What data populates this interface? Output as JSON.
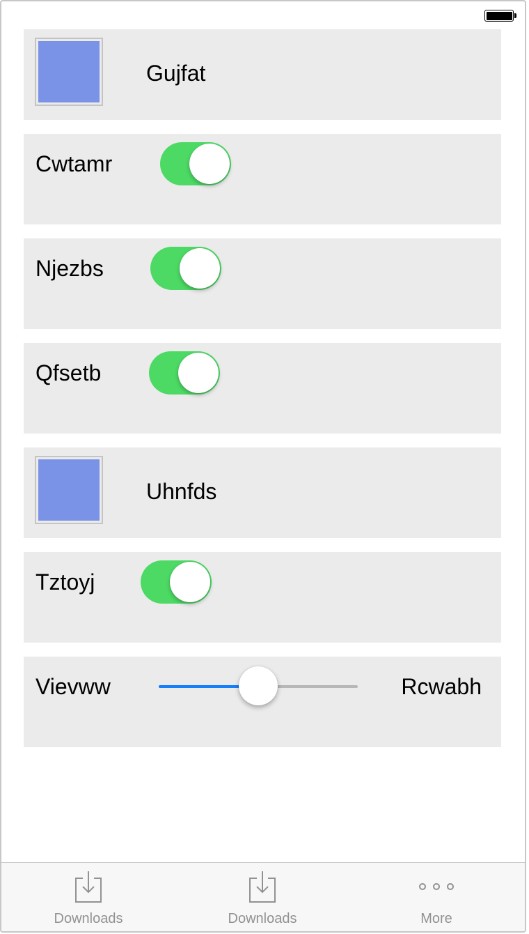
{
  "colors": {
    "switch_on": "#4cd964",
    "slider_fill": "#157efb",
    "swatch": "#7b93e6"
  },
  "rows": {
    "gujfat": {
      "label": "Gujfat",
      "swatch_color": "#7b93e6"
    },
    "cwtamr": {
      "label": "Cwtamr",
      "switch_on": true
    },
    "njezbs": {
      "label": "Njezbs",
      "switch_on": true
    },
    "qfsetb": {
      "label": "Qfsetb",
      "switch_on": true
    },
    "uhnfds": {
      "label": "Uhnfds",
      "swatch_color": "#7b93e6"
    },
    "tztoyj": {
      "label": "Tztoyj",
      "switch_on": true
    },
    "slider_row": {
      "left_label": "Vievww",
      "right_label": "Rcwabh",
      "value": 0.5
    }
  },
  "tab_bar": {
    "items": [
      {
        "label": "Downloads",
        "icon": "download-icon"
      },
      {
        "label": "Downloads",
        "icon": "download-icon"
      },
      {
        "label": "More",
        "icon": "more-icon"
      }
    ]
  }
}
